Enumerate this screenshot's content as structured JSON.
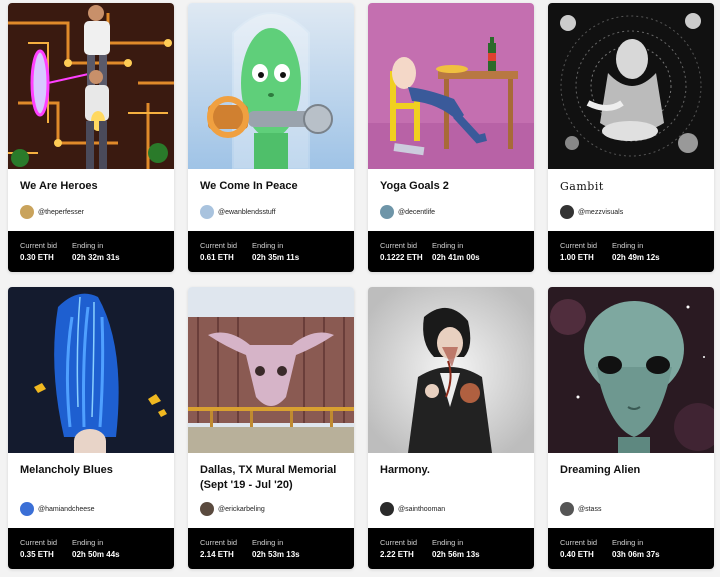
{
  "cards": [
    {
      "title": "We Are Heroes",
      "creator": "@theperfesser",
      "bid_label": "Current bid",
      "bid": "0.30 ETH",
      "ending_label": "Ending in",
      "ending": "02h  32m  31s",
      "avatar_color": "#c9a35c"
    },
    {
      "title": "We Come In Peace",
      "creator": "@ewanblendsstuff",
      "bid_label": "Current bid",
      "bid": "0.61 ETH",
      "ending_label": "Ending in",
      "ending": "02h  35m  11s",
      "avatar_color": "#a9c3de"
    },
    {
      "title": "Yoga Goals 2",
      "creator": "@decentlife",
      "bid_label": "Current bid",
      "bid": "0.1222 ETH",
      "ending_label": "Ending in",
      "ending": "02h  41m  00s",
      "avatar_color": "#6e95a8"
    },
    {
      "title": "Gambit",
      "creator": "@mezzvisuals",
      "bid_label": "Current bid",
      "bid": "1.00 ETH",
      "ending_label": "Ending in",
      "ending": "02h  49m  12s",
      "avatar_color": "#333333"
    },
    {
      "title": "Melancholy Blues",
      "creator": "@hamiandcheese",
      "bid_label": "Current bid",
      "bid": "0.35 ETH",
      "ending_label": "Ending in",
      "ending": "02h  50m  44s",
      "avatar_color": "#3b6fd6"
    },
    {
      "title": "Dallas, TX Mural Memorial (Sept '19 - Jul '20)",
      "creator": "@erickarbeling",
      "bid_label": "Current bid",
      "bid": "2.14 ETH",
      "ending_label": "Ending in",
      "ending": "02h  53m  13s",
      "avatar_color": "#5a4a3e"
    },
    {
      "title": "Harmony.",
      "creator": "@sainthooman",
      "bid_label": "Current bid",
      "bid": "2.22 ETH",
      "ending_label": "Ending in",
      "ending": "02h  56m  13s",
      "avatar_color": "#2a2a2a"
    },
    {
      "title": "Dreaming Alien",
      "creator": "@stass",
      "bid_label": "Current bid",
      "bid": "0.40 ETH",
      "ending_label": "Ending in",
      "ending": "03h  06m  37s",
      "avatar_color": "#555555"
    }
  ]
}
